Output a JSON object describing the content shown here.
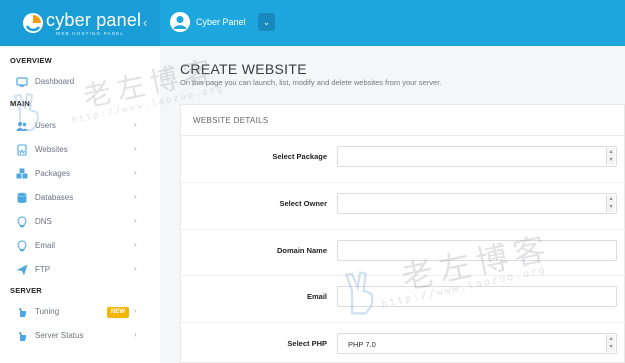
{
  "brand": {
    "name": "cyber panel",
    "tagline": "WEB HOSTING PANEL"
  },
  "header": {
    "user_name": "Cyber Panel"
  },
  "sidebar": {
    "sections": {
      "overview": "OVERVIEW",
      "main": "MAIN",
      "server": "SERVER"
    },
    "items": [
      {
        "label": "Dashboard",
        "icon": "dashboard-icon"
      },
      {
        "label": "Users",
        "icon": "users-icon"
      },
      {
        "label": "Websites",
        "icon": "websites-icon"
      },
      {
        "label": "Packages",
        "icon": "packages-icon"
      },
      {
        "label": "Databases",
        "icon": "databases-icon"
      },
      {
        "label": "DNS",
        "icon": "dns-icon"
      },
      {
        "label": "Email",
        "icon": "email-icon"
      },
      {
        "label": "FTP",
        "icon": "ftp-icon"
      },
      {
        "label": "Tuning",
        "icon": "tuning-icon",
        "badge": "NEW"
      },
      {
        "label": "Server Status",
        "icon": "server-status-icon"
      }
    ]
  },
  "page": {
    "title": "CREATE WEBSITE",
    "subtitle": "On this page you can launch, list, modify and delete websites from your server."
  },
  "form": {
    "section_title": "WEBSITE DETAILS",
    "fields": [
      {
        "label": "Select Package",
        "type": "select",
        "value": ""
      },
      {
        "label": "Select Owner",
        "type": "select",
        "value": ""
      },
      {
        "label": "Domain Name",
        "type": "text",
        "value": ""
      },
      {
        "label": "Email",
        "type": "text",
        "value": ""
      },
      {
        "label": "Select PHP",
        "type": "select",
        "value": "PHP 7.0"
      }
    ]
  },
  "watermark": {
    "text": "老左博客",
    "url": "http://www.laozuo.org"
  },
  "colors": {
    "header": "#1ea7df",
    "badge": "#f7b500",
    "sidebar_icon": "#4fa8e0"
  }
}
